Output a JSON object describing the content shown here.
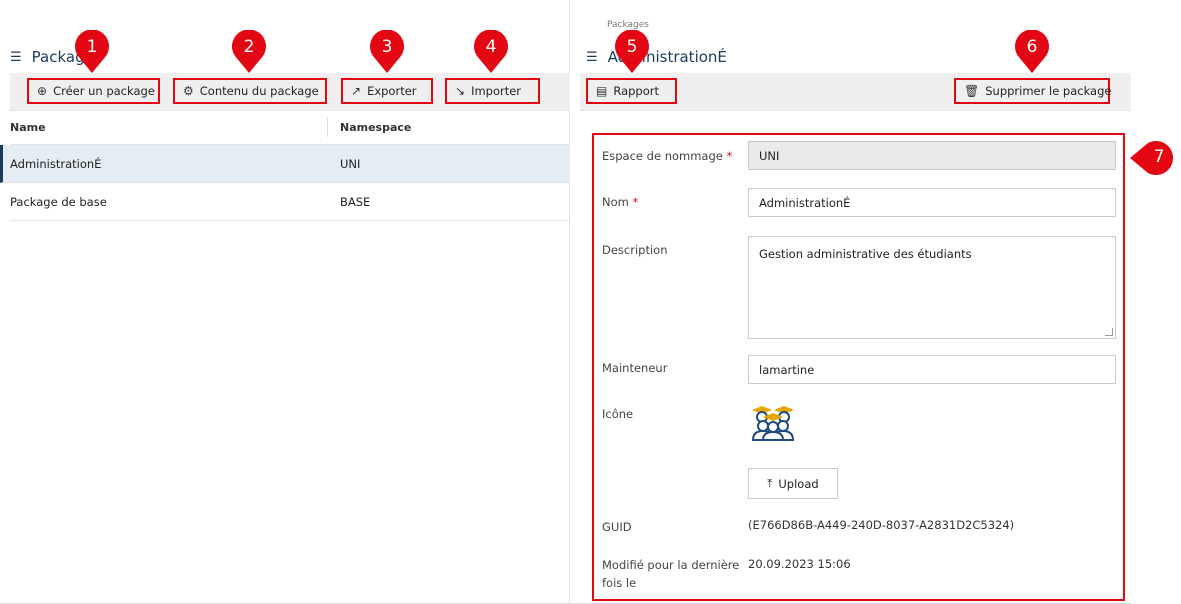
{
  "left": {
    "title": "Packages",
    "toolbar": {
      "create": "Créer un package",
      "content": "Contenu du package",
      "export": "Exporter",
      "import": "Importer"
    },
    "table": {
      "columns": [
        "Name",
        "Namespace"
      ],
      "rows": [
        {
          "name": "AdministrationÉ",
          "namespace": "UNI"
        },
        {
          "name": "Package de base",
          "namespace": "BASE"
        }
      ]
    }
  },
  "right": {
    "breadcrumb": "Packages",
    "title": "AdministrationÉ",
    "toolbar": {
      "report": "Rapport",
      "delete": "Supprimer le package"
    },
    "form": {
      "namespace_label": "Espace de nommage",
      "namespace_value": "UNI",
      "name_label": "Nom",
      "name_value": "AdministrationÉ",
      "description_label": "Description",
      "description_value": "Gestion administrative des étudiants",
      "maintainer_label": "Mainteneur",
      "maintainer_value": "lamartine",
      "icon_label": "Icône",
      "upload_label": "Upload",
      "guid_label": "GUID",
      "guid_value": "(E766D86B-A449-240D-8037-A2831D2C5324)",
      "modified_label": "Modifié pour la dernière fois le",
      "modified_value": "20.09.2023 15:06"
    }
  },
  "markers": [
    "1",
    "2",
    "3",
    "4",
    "5",
    "6",
    "7"
  ],
  "colors": {
    "annotation": "#e30613",
    "accent": "#1d3a5c",
    "selected_row": "#e4edf4"
  }
}
